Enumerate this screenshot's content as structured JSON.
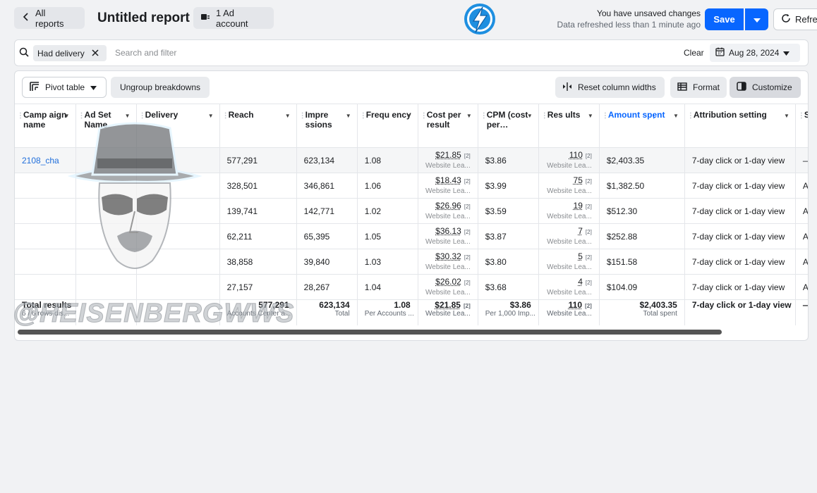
{
  "header": {
    "back_label": "All reports",
    "title": "Untitled report",
    "account_label": "1 Ad account",
    "unsaved_text": "You have unsaved changes",
    "refreshed_text": "Data refreshed less than 1 minute ago",
    "save_label": "Save",
    "refresh_label": "Refresh"
  },
  "filter": {
    "chip_label": "Had delivery",
    "placeholder": "Search and filter",
    "clear_label": "Clear",
    "date_label": "Aug 28, 2024"
  },
  "toolbar": {
    "pivot_label": "Pivot table",
    "ungroup_label": "Ungroup breakdowns",
    "reset_label": "Reset column widths",
    "format_label": "Format",
    "customize_label": "Customize"
  },
  "columns": [
    "Camp aign name",
    "Ad Set Name",
    "Delivery",
    "Reach",
    "Impre ssions",
    "Frequ ency",
    "Cost per result",
    "CPM (cost per…",
    "Res ults",
    "Amount spent",
    "Attribution setting",
    "S"
  ],
  "rows": [
    {
      "campaign": "2108_cha",
      "reach": "577,291",
      "impressions": "623,134",
      "frequency": "1.08",
      "cost": "$21.85",
      "cost_sub": "Website Lea...",
      "cpm": "$3.86",
      "results": "110",
      "results_sub": "Website Lea...",
      "amount": "$2,403.35",
      "attribution": "7-day click or 1-day view",
      "extra": "—"
    },
    {
      "campaign": "",
      "reach": "328,501",
      "impressions": "346,861",
      "frequency": "1.06",
      "cost": "$18.43",
      "cost_sub": "Website Lea...",
      "cpm": "$3.99",
      "results": "75",
      "results_sub": "Website Lea...",
      "amount": "$1,382.50",
      "attribution": "7-day click or 1-day view",
      "extra": "A"
    },
    {
      "campaign": "",
      "reach": "139,741",
      "impressions": "142,771",
      "frequency": "1.02",
      "cost": "$26.96",
      "cost_sub": "Website Lea...",
      "cpm": "$3.59",
      "results": "19",
      "results_sub": "Website Lea...",
      "amount": "$512.30",
      "attribution": "7-day click or 1-day view",
      "extra": "A"
    },
    {
      "campaign": "",
      "reach": "62,211",
      "impressions": "65,395",
      "frequency": "1.05",
      "cost": "$36.13",
      "cost_sub": "Website Lea...",
      "cpm": "$3.87",
      "results": "7",
      "results_sub": "Website Lea...",
      "amount": "$252.88",
      "attribution": "7-day click or 1-day view",
      "extra": "A"
    },
    {
      "campaign": "",
      "reach": "38,858",
      "impressions": "39,840",
      "frequency": "1.03",
      "cost": "$30.32",
      "cost_sub": "Website Lea...",
      "cpm": "$3.80",
      "results": "5",
      "results_sub": "Website Lea...",
      "amount": "$151.58",
      "attribution": "7-day click or 1-day view",
      "extra": "A"
    },
    {
      "campaign": "",
      "reach": "27,157",
      "impressions": "28,267",
      "frequency": "1.04",
      "cost": "$26.02",
      "cost_sub": "Website Lea...",
      "cpm": "$3.68",
      "results": "4",
      "results_sub": "Website Lea...",
      "amount": "$104.09",
      "attribution": "7-day click or 1-day view",
      "extra": "A"
    }
  ],
  "totals": {
    "label": "Total results",
    "label_sub": "6 / 6 rows dis...",
    "reach": "577,291",
    "reach_sub": "Accounts Center a...",
    "impressions": "623,134",
    "impressions_sub": "Total",
    "frequency": "1.08",
    "frequency_sub": "Per Accounts ...",
    "cost": "$21.85",
    "cost_sub": "Website Lea...",
    "cpm": "$3.86",
    "cpm_sub": "Per 1,000 Imp...",
    "results": "110",
    "results_sub": "Website Lea...",
    "amount": "$2,403.35",
    "amount_sub": "Total spent",
    "attribution": "7-day click or 1-day view",
    "extra": "—"
  },
  "footnote_marker": "[2]",
  "watermark": "@HEISENBERGWWS",
  "colors": {
    "accent": "#0866ff",
    "link": "#216fdb",
    "background": "#f1f2f4"
  }
}
